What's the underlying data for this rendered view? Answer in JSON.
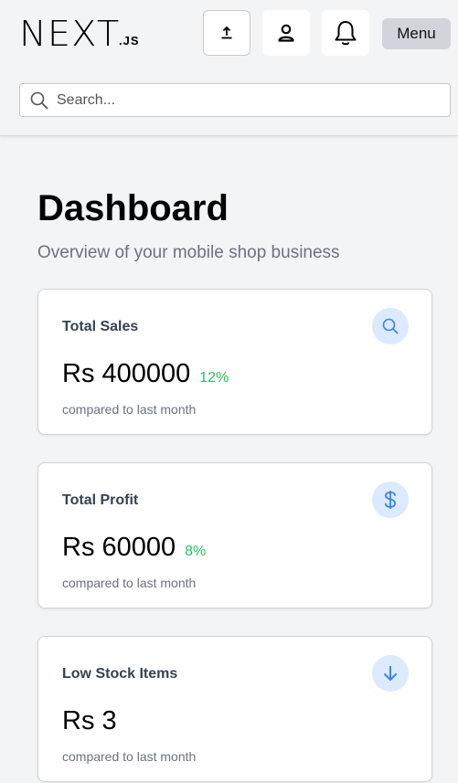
{
  "header": {
    "logo_main": "NEXT",
    "logo_sub": ".JS",
    "upload_icon": "upload-icon",
    "user_icon": "user-icon",
    "bell_icon": "bell-icon",
    "menu_label": "Menu"
  },
  "search": {
    "placeholder": "Search...",
    "value": "",
    "icon": "search-icon"
  },
  "main": {
    "title": "Dashboard",
    "subtitle": "Overview of your mobile shop business",
    "cards": [
      {
        "label": "Total Sales",
        "value": "Rs 400000",
        "change": "12%",
        "note": "compared to last month",
        "icon": "search-icon"
      },
      {
        "label": "Total Profit",
        "value": "Rs 60000",
        "change": "8%",
        "note": "compared to last month",
        "icon": "dollar-icon"
      },
      {
        "label": "Low Stock Items",
        "value": "Rs 3",
        "change": "",
        "note": "compared to last month",
        "icon": "arrow-down-icon"
      }
    ]
  },
  "colors": {
    "background": "#f3f4f6",
    "accent_blue": "#3b82f6",
    "icon_bg": "#dbeafe",
    "positive_change": "#22c55e",
    "muted_text": "#6b7280",
    "menu_button": "#d1d5db"
  }
}
